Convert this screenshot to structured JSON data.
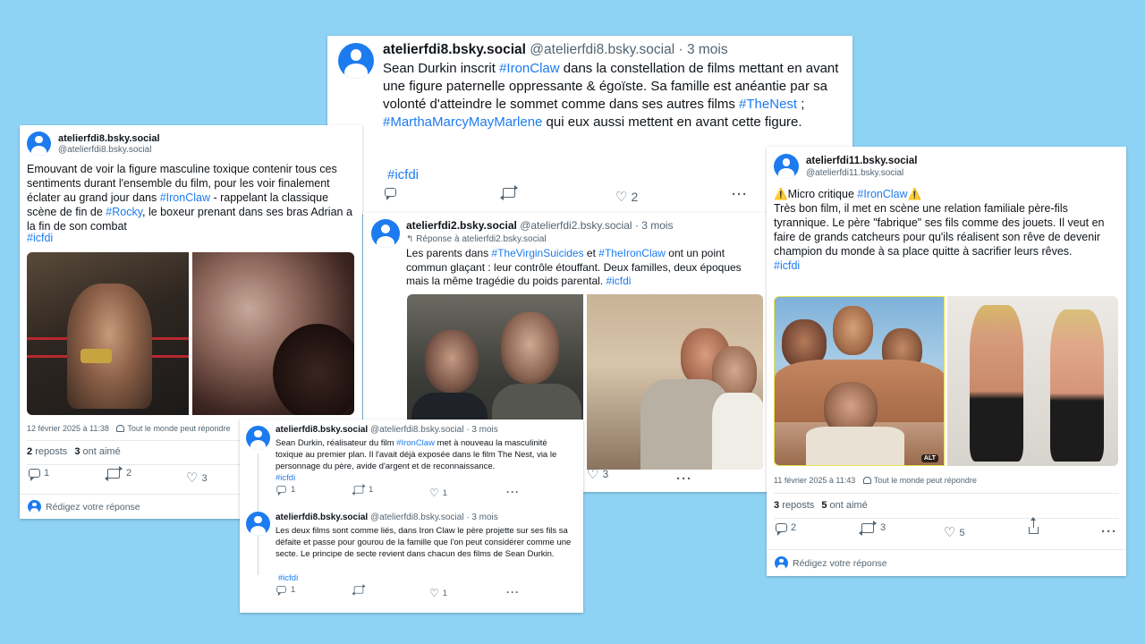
{
  "post_top": {
    "display": "atelierfdi8.bsky.social",
    "handle": "@atelierfdi8.bsky.social",
    "age": "· 3 mois",
    "text_parts": [
      "Sean Durkin inscrit ",
      "#IronClaw",
      " dans la constellation de films mettant en avant une figure paternelle oppressante & égoïste. Sa famille est anéantie par sa volonté d'atteindre le sommet comme dans ses autres films ",
      "#TheNest",
      " ; ",
      "#MarthaMarcyMayMarlene",
      " qui eux aussi mettent en avant cette figure."
    ],
    "hashtag": "#icfdi",
    "likes": "2"
  },
  "post_left": {
    "display": "atelierfdi8.bsky.social",
    "handle": "@atelierfdi8.bsky.social",
    "text_parts": [
      "Emouvant de voir la figure masculine toxique contenir tous ces sentiments durant l'ensemble du film, pour les voir finalement éclater au grand jour dans ",
      "#IronClaw",
      " - rappelant la classique scène de fin de ",
      "#Rocky",
      ", le boxeur prenant dans ses bras Adrian a la fin de son combat"
    ],
    "hashtag": "#icfdi",
    "date": "12 février 2025 à 11:38",
    "audience": "Tout le monde peut répondre",
    "reposts_count": "2",
    "reposts_label": "reposts",
    "likes_count": "3",
    "likes_label": "ont aimé",
    "replies": "1",
    "reposts": "2",
    "likes": "3",
    "reply_prompt": "Rédigez votre réponse"
  },
  "post_center": {
    "display": "atelierfdi2.bsky.social",
    "handle": "@atelierfdi2.bsky.social",
    "age": "· 3 mois",
    "reply_to": "Réponse à atelierfdi2.bsky.social",
    "text_parts": [
      "Les parents dans ",
      "#TheVirginSuicides",
      " et ",
      "#TheIronClaw",
      " ont un point commun glaçant : leur contrôle étouffant. Deux familles, deux époques mais la même tragédie du poids parental. ",
      "#icfdi"
    ],
    "likes": "3"
  },
  "thread_bottom": {
    "reply1": {
      "display": "atelierfdi8.bsky.social",
      "handle": "@atelierfdi8.bsky.social",
      "age": "· 3 mois",
      "text_parts": [
        "Sean Durkin, réalisateur du film ",
        "#IronClaw",
        " met à nouveau la masculinité toxique au premier plan. Il l'avait déjà exposée dans le film The Nest, via le personnage du père, avide d'argent et de reconnaissance."
      ],
      "hashtag": "#icfdi",
      "replies": "1",
      "reposts": "1",
      "likes": "1"
    },
    "reply2": {
      "display": "atelierfdi8.bsky.social",
      "handle": "@atelierfdi8.bsky.social",
      "age": "· 3 mois",
      "text": "Les deux films sont comme liés, dans Iron Claw le père projette sur ses fils sa défaite et passe pour gourou de la famille que l'on peut considérer comme une secte. Le principe de secte revient dans chacun des films de Sean Durkin.",
      "hashtag": "#icfdi",
      "replies": "1",
      "likes": "1"
    }
  },
  "post_right": {
    "display": "atelierfdi11.bsky.social",
    "handle": "@atelierfdi11.bsky.social",
    "warning": "⚠️",
    "title_pre": "Micro critique ",
    "title_tag": "#IronClaw",
    "text": "Très bon film, il met en scène une relation familiale père-fils tyrannique. Le père \"fabrique\" ses fils comme des jouets. Il veut en faire de grands catcheurs pour qu'ils réalisent son rêve de devenir champion du monde à sa place quitte à sacrifier leurs rêves.",
    "hashtag": "#icfdi",
    "alt": "ALT",
    "date": "11 février 2025 à 11:43",
    "audience": "Tout le monde peut répondre",
    "reposts_count": "3",
    "reposts_label": "reposts",
    "likes_count": "5",
    "likes_label": "ont aimé",
    "replies": "2",
    "reposts": "3",
    "likes": "5",
    "reply_prompt": "Rédigez votre réponse"
  }
}
